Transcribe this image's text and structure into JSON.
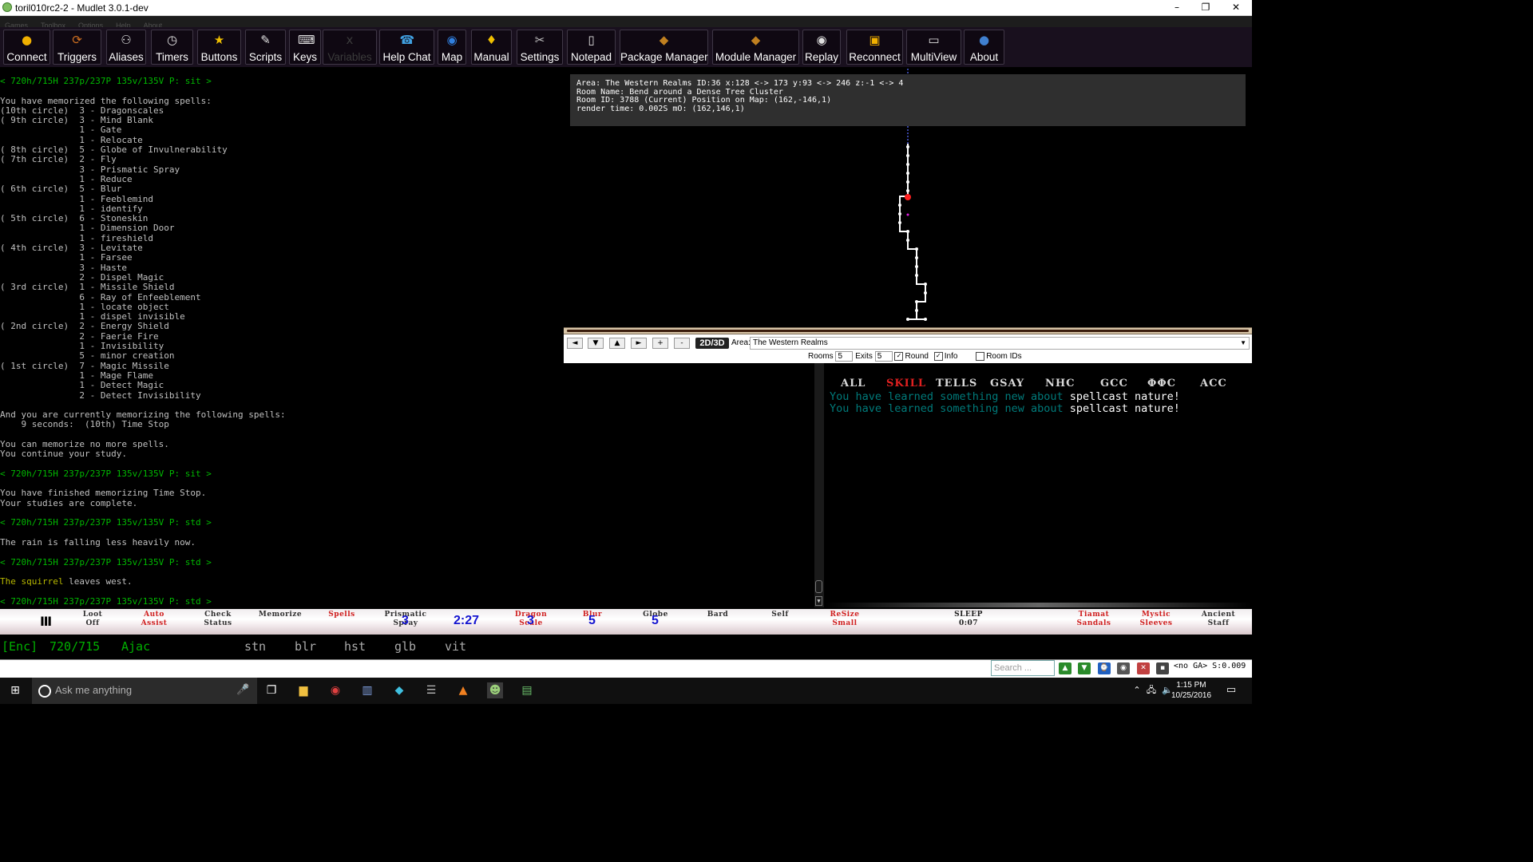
{
  "window": {
    "title": "toril010rc2-2 - Mudlet 3.0.1-dev",
    "minimize": "–",
    "restore": "❐",
    "close": "✕"
  },
  "menu": [
    "Games",
    "Toolbox",
    "Options",
    "Help",
    "About"
  ],
  "toolbar": [
    {
      "label": "Connect",
      "icon": "connect-icon",
      "glyph": "●",
      "color": "#f0b000"
    },
    {
      "label": "Triggers",
      "icon": "triggers-icon",
      "glyph": "⟳",
      "color": "#d07020"
    },
    {
      "label": "Aliases",
      "icon": "aliases-icon",
      "glyph": "⚇",
      "color": "#e0e0e0"
    },
    {
      "label": "Timers",
      "icon": "timers-icon",
      "glyph": "◷",
      "color": "#e0e0e0"
    },
    {
      "label": "Buttons",
      "icon": "buttons-icon",
      "glyph": "★",
      "color": "#f0c000"
    },
    {
      "label": "Scripts",
      "icon": "scripts-icon",
      "glyph": "✎",
      "color": "#e0e0e0"
    },
    {
      "label": "Keys",
      "icon": "keys-icon",
      "glyph": "⌨",
      "color": "#e0e0e0"
    },
    {
      "label": "Variables",
      "icon": "variables-icon",
      "glyph": "x",
      "color": "#3b3b3b",
      "dim": true
    },
    {
      "label": "Help Chat",
      "icon": "help-chat-icon",
      "glyph": "☎",
      "color": "#40a0e0"
    },
    {
      "label": "Map",
      "icon": "map-icon",
      "glyph": "◉",
      "color": "#3080e0"
    },
    {
      "label": "Manual",
      "icon": "manual-icon",
      "glyph": "♦",
      "color": "#f0c000"
    },
    {
      "label": "Settings",
      "icon": "settings-icon",
      "glyph": "✂",
      "color": "#c0c0c0"
    },
    {
      "label": "Notepad",
      "icon": "notepad-icon",
      "glyph": "▯",
      "color": "#e0e0e0"
    },
    {
      "label": "Package Manager",
      "icon": "package-manager-icon",
      "glyph": "◆",
      "color": "#c08020"
    },
    {
      "label": "Module Manager",
      "icon": "module-manager-icon",
      "glyph": "◆",
      "color": "#c08020"
    },
    {
      "label": "Replay",
      "icon": "replay-icon",
      "glyph": "◉",
      "color": "#e0e0e0"
    },
    {
      "label": "Reconnect",
      "icon": "reconnect-icon",
      "glyph": "▣",
      "color": "#f0b000"
    },
    {
      "label": "MultiView",
      "icon": "multiview-icon",
      "glyph": "▭",
      "color": "#e0e0e0"
    },
    {
      "label": "About",
      "icon": "about-icon",
      "glyph": "●",
      "color": "#4080d0"
    }
  ],
  "main_output": [
    {
      "t": "< 720h/715H 237p/237P 135v/135V P: sit >",
      "c": "prompt"
    },
    {
      "t": ""
    },
    {
      "t": "You have memorized the following spells:"
    },
    {
      "t": "(10th circle)  3 - Dragonscales"
    },
    {
      "t": "( 9th circle)  3 - Mind Blank"
    },
    {
      "t": "               1 - Gate"
    },
    {
      "t": "               1 - Relocate"
    },
    {
      "t": "( 8th circle)  5 - Globe of Invulnerability"
    },
    {
      "t": "( 7th circle)  2 - Fly"
    },
    {
      "t": "               3 - Prismatic Spray"
    },
    {
      "t": "               1 - Reduce"
    },
    {
      "t": "( 6th circle)  5 - Blur"
    },
    {
      "t": "               1 - Feeblemind"
    },
    {
      "t": "               1 - identify"
    },
    {
      "t": "( 5th circle)  6 - Stoneskin"
    },
    {
      "t": "               1 - Dimension Door"
    },
    {
      "t": "               1 - fireshield"
    },
    {
      "t": "( 4th circle)  3 - Levitate"
    },
    {
      "t": "               1 - Farsee"
    },
    {
      "t": "               3 - Haste"
    },
    {
      "t": "               2 - Dispel Magic"
    },
    {
      "t": "( 3rd circle)  1 - Missile Shield"
    },
    {
      "t": "               6 - Ray of Enfeeblement"
    },
    {
      "t": "               1 - locate object"
    },
    {
      "t": "               1 - dispel invisible"
    },
    {
      "t": "( 2nd circle)  2 - Energy Shield"
    },
    {
      "t": "               2 - Faerie Fire"
    },
    {
      "t": "               1 - Invisibility"
    },
    {
      "t": "               5 - minor creation"
    },
    {
      "t": "( 1st circle)  7 - Magic Missile"
    },
    {
      "t": "               1 - Mage Flame"
    },
    {
      "t": "               1 - Detect Magic"
    },
    {
      "t": "               2 - Detect Invisibility"
    },
    {
      "t": ""
    },
    {
      "t": "And you are currently memorizing the following spells:"
    },
    {
      "t": "    9 seconds:  (10th) Time Stop"
    },
    {
      "t": ""
    },
    {
      "t": "You can memorize no more spells."
    },
    {
      "t": "You continue your study."
    },
    {
      "t": ""
    },
    {
      "t": "< 720h/715H 237p/237P 135v/135V P: sit >",
      "c": "prompt"
    },
    {
      "t": ""
    },
    {
      "t": "You have finished memorizing Time Stop."
    },
    {
      "t": "Your studies are complete."
    },
    {
      "t": ""
    },
    {
      "t": "< 720h/715H 237p/237P 135v/135V P: std >",
      "c": "prompt"
    },
    {
      "t": ""
    },
    {
      "t": "The rain is falling less heavily now."
    },
    {
      "t": ""
    },
    {
      "t": "< 720h/715H 237p/237P 135v/135V P: std >",
      "c": "prompt"
    },
    {
      "t": ""
    },
    {
      "t": "The squirrel leaves west.",
      "c": "squirrel"
    },
    {
      "t": ""
    },
    {
      "t": "< 720h/715H 237p/237P 135v/135V P: std >",
      "c": "prompt"
    }
  ],
  "squirrel_parts": [
    "The squirrel",
    " leaves west."
  ],
  "map_info": {
    "line1": "Area: The Western Realms ID:36 x:128 <-> 173 y:93 <-> 246 z:-1 <-> 4",
    "line2": "Room Name: Bend around a Dense Tree Cluster",
    "line3": "Room ID: 3788 (Current) Position on Map: (162,-146,1)",
    "line4": "render time: 0.002S mO: (162,146,1)"
  },
  "map_controls": {
    "btn_left": "◄",
    "btn_down": "▼",
    "btn_up": "▲",
    "btn_right": "►",
    "btn_plus": "+",
    "btn_minus": "-",
    "btn_2d3d": "2D/3D",
    "area_label": "Area:",
    "area_value": "The Western Realms",
    "rooms_label": "Rooms",
    "rooms_value": "5",
    "exits_label": "Exits",
    "exits_value": "5",
    "round_label": "Round",
    "round_checked": true,
    "info_label": "Info",
    "info_checked": true,
    "roomids_label": "Room IDs",
    "roomids_checked": false
  },
  "chat": {
    "tabs": [
      "ALL",
      "SKILL",
      "TELLS",
      "GSAY",
      "NHC",
      "GCC",
      "ΦΦC",
      "ACC"
    ],
    "active_tab": "SKILL",
    "lines": [
      {
        "pre": "You have learned something new about ",
        "post": "spellcast nature!"
      },
      {
        "pre": "You have learned something new about ",
        "post": "spellcast nature!"
      }
    ]
  },
  "bottom_bar": [
    {
      "top": "Loot",
      "bottom": "Off",
      "color": "#303030"
    },
    {
      "top": "Auto",
      "bottom": "Assist",
      "color": "#d02020"
    },
    {
      "top": "Check",
      "bottom": "Status",
      "color": "#303030"
    },
    {
      "top": "Memorize",
      "bottom": "",
      "color": "#303030"
    },
    {
      "top": "Spells",
      "bottom": "",
      "color": "#d02020"
    },
    {
      "top": "Prismatic",
      "bottom": "Spray",
      "color": "#303030",
      "num": "3"
    },
    {
      "top": "",
      "bottom": "",
      "color": "#303030",
      "num": "2:27"
    },
    {
      "top": "Dragon",
      "bottom": "Scale",
      "color": "#d02020",
      "num": "3"
    },
    {
      "top": "Blur",
      "bottom": "",
      "color": "#d02020",
      "num": "5"
    },
    {
      "top": "Globe",
      "bottom": "",
      "color": "#303030",
      "num": "5"
    },
    {
      "top": "Bard",
      "bottom": "",
      "color": "#303030"
    },
    {
      "top": "Self",
      "bottom": "",
      "color": "#303030"
    },
    {
      "top": "ReSize",
      "bottom": "Small",
      "color": "#d02020"
    },
    {
      "top": "SLEEP",
      "bottom": "0:07",
      "color": "#202020"
    },
    {
      "top": "Tiamat",
      "bottom": "Sandals",
      "color": "#d02020"
    },
    {
      "top": "Mystic",
      "bottom": "Sleeves",
      "color": "#d02020"
    },
    {
      "top": "Ancient",
      "bottom": "Staff",
      "color": "#303030"
    }
  ],
  "status": {
    "enc": "[Enc]",
    "hp": "720/715",
    "name": "Ajac",
    "affects": [
      "stn",
      "blr",
      "hst",
      "glb",
      "vit"
    ]
  },
  "command": {
    "search_placeholder": "Search ...",
    "lag": "<no GA> S:0.009"
  },
  "taskbar": {
    "search_text": "Ask me anything",
    "time": "1:15 PM",
    "date": "10/25/2016"
  }
}
